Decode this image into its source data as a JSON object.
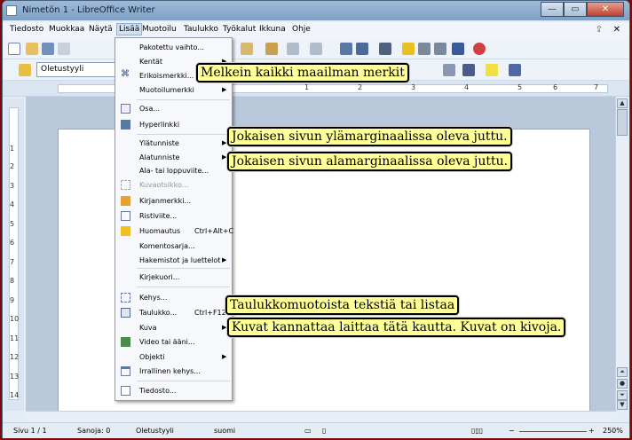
{
  "window": {
    "title": "Nimetön 1 - LibreOffice Writer",
    "minimize": "—",
    "maximize": "▭",
    "close": "✕"
  },
  "menubar": {
    "items": [
      "Tiedosto",
      "Muokkaa",
      "Näytä",
      "Lisää",
      "Muotoilu",
      "Taulukko",
      "Työkalut",
      "Ikkuna",
      "Ohje"
    ],
    "close_doc": "✕"
  },
  "toolbar": {
    "style_value": "Oletustyyli"
  },
  "ruler": {
    "numbers": [
      "1",
      "2",
      "3",
      "4",
      "5",
      "6",
      "7"
    ]
  },
  "vruler": {
    "numbers": [
      "1",
      "2",
      "3",
      "4",
      "5",
      "6",
      "7",
      "8",
      "9",
      "10",
      "11",
      "12",
      "13",
      "14"
    ]
  },
  "insert_menu": {
    "items": [
      {
        "label": "Pakotettu vaihto...",
        "icon": "",
        "submenu": false
      },
      {
        "label": "Kentät",
        "icon": "",
        "submenu": true
      },
      {
        "label": "Erikoismerkki...",
        "icon": "omega-icon",
        "submenu": false
      },
      {
        "label": "Muotoilumerkki",
        "icon": "",
        "submenu": true
      },
      {
        "label": "Osa...",
        "icon": "section-icon",
        "submenu": false
      },
      {
        "label": "Hyperlinkki",
        "icon": "hyperlink-icon",
        "submenu": false
      },
      {
        "label": "Ylätunniste",
        "icon": "",
        "submenu": true
      },
      {
        "label": "Alatunniste",
        "icon": "",
        "submenu": true
      },
      {
        "label": "Ala- tai loppuviite...",
        "icon": "",
        "submenu": false
      },
      {
        "label": "Kuvaotsikko...",
        "icon": "caption-icon",
        "submenu": false,
        "disabled": true
      },
      {
        "label": "Kirjanmerkki...",
        "icon": "bookmark-icon",
        "submenu": false
      },
      {
        "label": "Ristiviite...",
        "icon": "cross-reference-icon",
        "submenu": false
      },
      {
        "label": "Huomautus",
        "shortcut": "Ctrl+Alt+C",
        "icon": "comment-icon",
        "submenu": false
      },
      {
        "label": "Komentosarja...",
        "icon": "",
        "submenu": false
      },
      {
        "label": "Hakemistot ja luettelot",
        "icon": "",
        "submenu": true
      },
      {
        "label": "Kirjekuori...",
        "icon": "",
        "submenu": false
      },
      {
        "label": "Kehys...",
        "icon": "frame-icon",
        "submenu": false
      },
      {
        "label": "Taulukko...",
        "shortcut": "Ctrl+F12",
        "icon": "table-icon",
        "submenu": false
      },
      {
        "label": "Kuva",
        "icon": "",
        "submenu": true
      },
      {
        "label": "Video tai ääni...",
        "icon": "movie-icon",
        "submenu": false
      },
      {
        "label": "Objekti",
        "icon": "",
        "submenu": true
      },
      {
        "label": "Irrallinen kehys...",
        "icon": "floating-frame-icon",
        "submenu": false
      },
      {
        "label": "Tiedosto...",
        "icon": "file-icon",
        "submenu": false
      }
    ]
  },
  "callouts": [
    "Melkein kaikki maailman merkit",
    "Jokaisen sivun ylämarginaalissa oleva juttu.",
    "Jokaisen sivun alamarginaalissa oleva juttu.",
    "Taulukkomuotoista tekstiä tai listaa",
    "Kuvat kannattaa laittaa tätä kautta. Kuvat on kivoja."
  ],
  "statusbar": {
    "page": "Sivu 1 / 1",
    "words": "Sanoja: 0",
    "style": "Oletustyyli",
    "language": "suomi",
    "zoom": "250%"
  },
  "colors": {
    "callout_bg": "#ffff99",
    "menu_bg": "#f6f8fb",
    "window_bg": "#e4ecf6"
  }
}
